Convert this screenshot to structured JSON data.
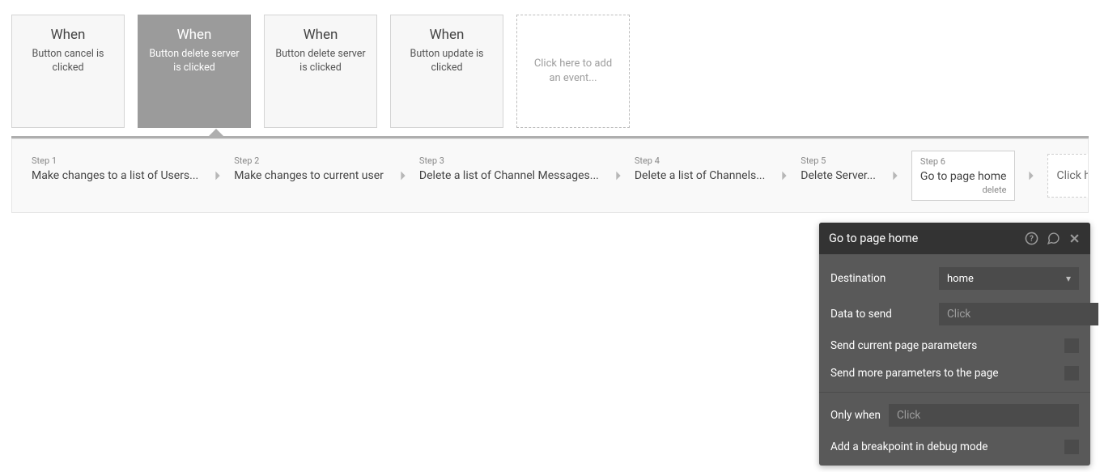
{
  "events": [
    {
      "title": "When",
      "desc": "Button cancel is clicked",
      "selected": false
    },
    {
      "title": "When",
      "desc": "Button delete server is clicked",
      "selected": true
    },
    {
      "title": "When",
      "desc": "Button delete server is clicked",
      "selected": false
    },
    {
      "title": "When",
      "desc": "Button update is clicked",
      "selected": false
    }
  ],
  "add_event_placeholder": "Click here to add an event...",
  "steps": [
    {
      "num": "Step 1",
      "label": "Make changes to a list of Users..."
    },
    {
      "num": "Step 2",
      "label": "Make changes to current user"
    },
    {
      "num": "Step 3",
      "label": "Delete a list of Channel Messages..."
    },
    {
      "num": "Step 4",
      "label": "Delete a list of Channels..."
    },
    {
      "num": "Step 5",
      "label": "Delete Server..."
    },
    {
      "num": "Step 6",
      "label": "Go to page home",
      "sub": "delete",
      "selected": true
    }
  ],
  "add_action_placeholder": "Click here to add an action...",
  "panel": {
    "title": "Go to page home",
    "destination_label": "Destination",
    "destination_value": "home",
    "data_to_send_label": "Data to send",
    "data_to_send_placeholder": "Click",
    "send_current_label": "Send current page parameters",
    "send_more_label": "Send more parameters to the page",
    "only_when_label": "Only when",
    "only_when_placeholder": "Click",
    "breakpoint_label": "Add a breakpoint in debug mode"
  }
}
